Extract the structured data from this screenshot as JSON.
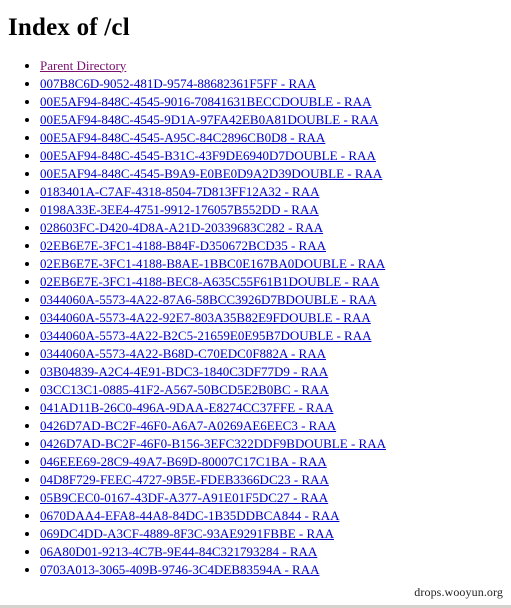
{
  "page": {
    "title": "Index of /cl",
    "watermark": "drops.wooyun.org"
  },
  "listing": {
    "parent": {
      "label": "Parent Directory",
      "state": "visited",
      "color": "#7a0f6e"
    },
    "link_color": "#0000cc",
    "entries": [
      "007B8C6D-9052-481D-9574-88682361F5FF - RAA",
      "00E5AF94-848C-4545-9016-70841631BECCDOUBLE - RAA",
      "00E5AF94-848C-4545-9D1A-97FA42EB0A81DOUBLE - RAA",
      "00E5AF94-848C-4545-A95C-84C2896CB0D8 - RAA",
      "00E5AF94-848C-4545-B31C-43F9DE6940D7DOUBLE - RAA",
      "00E5AF94-848C-4545-B9A9-E0BE0D9A2D39DOUBLE - RAA",
      "0183401A-C7AF-4318-8504-7D813FF12A32 - RAA",
      "0198A33E-3EE4-4751-9912-176057B552DD - RAA",
      "028603FC-D420-4D8A-A21D-20339683C282 - RAA",
      "02EB6E7E-3FC1-4188-B84F-D350672BCD35 - RAA",
      "02EB6E7E-3FC1-4188-B8AE-1BBC0E167BA0DOUBLE - RAA",
      "02EB6E7E-3FC1-4188-BEC8-A635C55F61B1DOUBLE - RAA",
      "0344060A-5573-4A22-87A6-58BCC3926D7BDOUBLE - RAA",
      "0344060A-5573-4A22-92E7-803A35B82E9FDOUBLE - RAA",
      "0344060A-5573-4A22-B2C5-21659E0E95B7DOUBLE - RAA",
      "0344060A-5573-4A22-B68D-C70EDC0F882A - RAA",
      "03B04839-A2C4-4E91-BDC3-1840C3DF77D9 - RAA",
      "03CC13C1-0885-41F2-A567-50BCD5E2B0BC - RAA",
      "041AD11B-26C0-496A-9DAA-E8274CC37FFE - RAA",
      "0426D7AD-BC2F-46F0-A6A7-A0269AE6EEC3 - RAA",
      "0426D7AD-BC2F-46F0-B156-3EFC322DDF9BDOUBLE - RAA",
      "046EEE69-28C9-49A7-B69D-80007C17C1BA - RAA",
      "04D8F729-FEEC-4727-9B5E-FDEB3366DC23 - RAA",
      "05B9CEC0-0167-43DF-A377-A91E01F5DC27 - RAA",
      "0670DAA4-EFA8-44A8-84DC-1B35DDBCA844 - RAA",
      "069DC4DD-A3CF-4889-8F3C-93AE9291FBBE - RAA",
      "06A80D01-9213-4C7B-9E44-84C321793284 - RAA",
      "0703A013-3065-409B-9746-3C4DEB83594A - RAA"
    ]
  }
}
